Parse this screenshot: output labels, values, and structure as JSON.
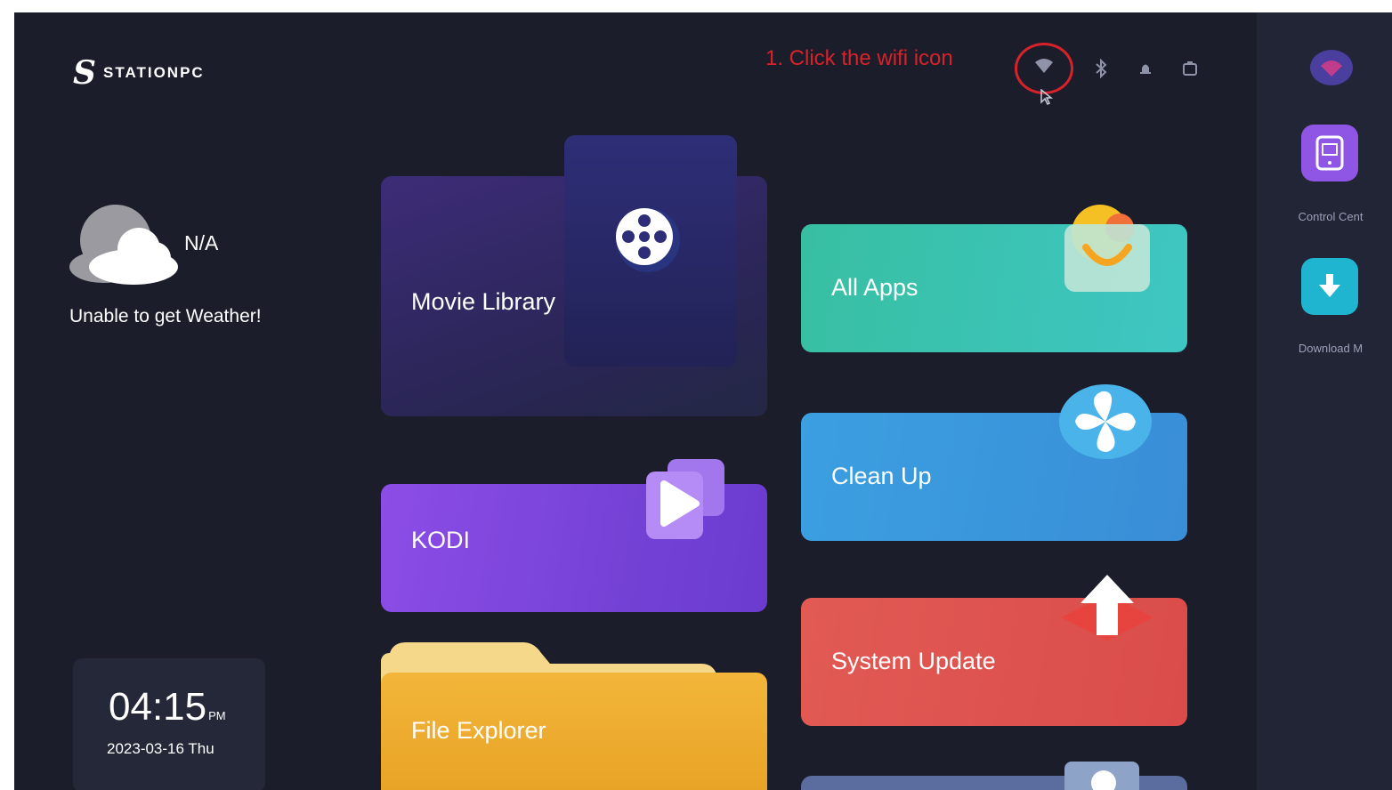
{
  "logo": {
    "mark": "S",
    "text": "STATIONPC"
  },
  "annotation": {
    "text": "1. Click the wifi icon"
  },
  "status_icons": [
    "wifi-icon",
    "bluetooth-icon",
    "notification-icon",
    "storage-icon"
  ],
  "weather": {
    "temp": "N/A",
    "message": "Unable to get Weather!"
  },
  "clock": {
    "time": "04:15",
    "ampm": "PM",
    "date": "2023-03-16  Thu"
  },
  "tiles": {
    "movie": "Movie Library",
    "kodi": "KODI",
    "file_explorer": "File Explorer",
    "all_apps": "All Apps",
    "clean_up": "Clean Up",
    "system_update": "System Update"
  },
  "side_apps": [
    {
      "label": "Control Cent",
      "icon": "control-center-icon"
    },
    {
      "label": "Download M",
      "icon": "download-icon"
    }
  ],
  "colors": {
    "annotation": "#d8222a",
    "background": "#1b1d2b",
    "all_apps": "#3ec6c3",
    "clean_up": "#3a8ed7",
    "system_update": "#d94c4a",
    "kodi": "#7a45dc",
    "file_explorer": "#eeab2c"
  }
}
